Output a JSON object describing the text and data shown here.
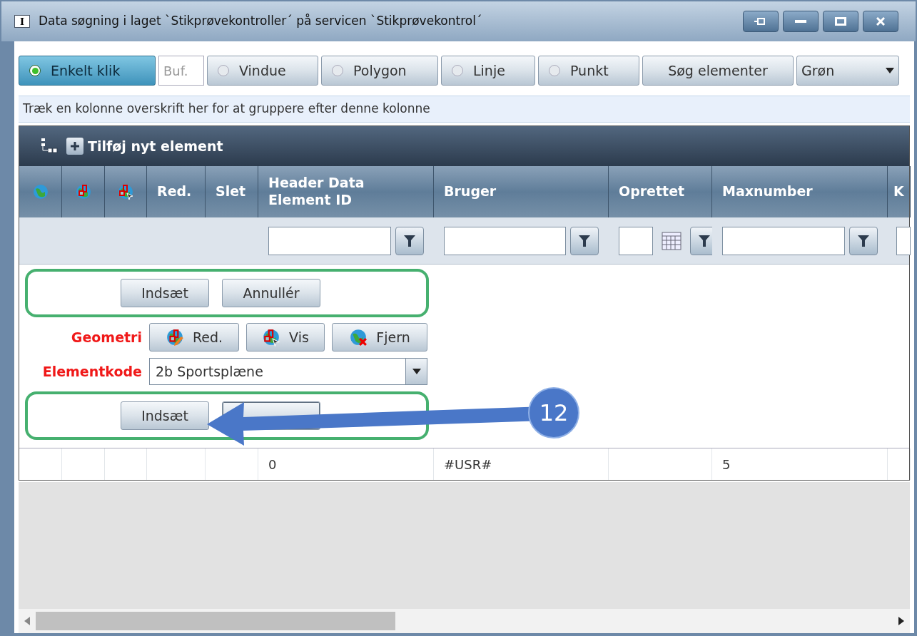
{
  "window": {
    "icon_letter": "I",
    "title": "Data søgning i laget `Stikprøvekontroller´ på servicen `Stikprøvekontrol´"
  },
  "toolbar": {
    "modes": [
      {
        "label": "Enkelt klik",
        "selected": true
      },
      {
        "label": "Vindue",
        "selected": false
      },
      {
        "label": "Polygon",
        "selected": false
      },
      {
        "label": "Linje",
        "selected": false
      },
      {
        "label": "Punkt",
        "selected": false
      }
    ],
    "buffer": {
      "placeholder": "Buf."
    },
    "search_button": "Søg elementer",
    "color_select": {
      "value": "Grøn"
    }
  },
  "group_panel": "Træk en kolonne overskrift her for at gruppere efter denne kolonne",
  "grid": {
    "add_button": "Tilføj nyt element",
    "columns": [
      {
        "kind": "icon"
      },
      {
        "kind": "icon"
      },
      {
        "kind": "icon"
      },
      {
        "kind": "text",
        "label": "Red."
      },
      {
        "kind": "text",
        "label": "Slet"
      },
      {
        "kind": "text",
        "label": "Header Data Element ID",
        "filter": {
          "kind": "text"
        }
      },
      {
        "kind": "text",
        "label": "Bruger",
        "filter": {
          "kind": "text"
        }
      },
      {
        "kind": "text",
        "label": "Oprettet",
        "filter": {
          "kind": "date"
        }
      },
      {
        "kind": "text",
        "label": "Maxnumber",
        "filter": {
          "kind": "text"
        }
      },
      {
        "kind": "text",
        "label": "K",
        "filter": {
          "kind": "text"
        }
      }
    ],
    "rows": [
      {
        "cells": [
          null,
          null,
          null,
          null,
          null,
          "0",
          "#USR#",
          null,
          "5",
          null
        ]
      }
    ]
  },
  "edit_form": {
    "top_actions": [
      {
        "label": "Indsæt",
        "covered": false
      },
      {
        "label": "Annullér",
        "covered": false
      }
    ],
    "geometry": {
      "label": "Geometri",
      "buttons": [
        "Red.",
        "Vis",
        "Fjern"
      ]
    },
    "element_code": {
      "label": "Elementkode",
      "value": "2b Sportsplæne"
    },
    "bottom_actions": [
      {
        "label": "Indsæt",
        "covered": false
      },
      {
        "covered": true
      }
    ]
  },
  "callout": {
    "number": "12"
  }
}
